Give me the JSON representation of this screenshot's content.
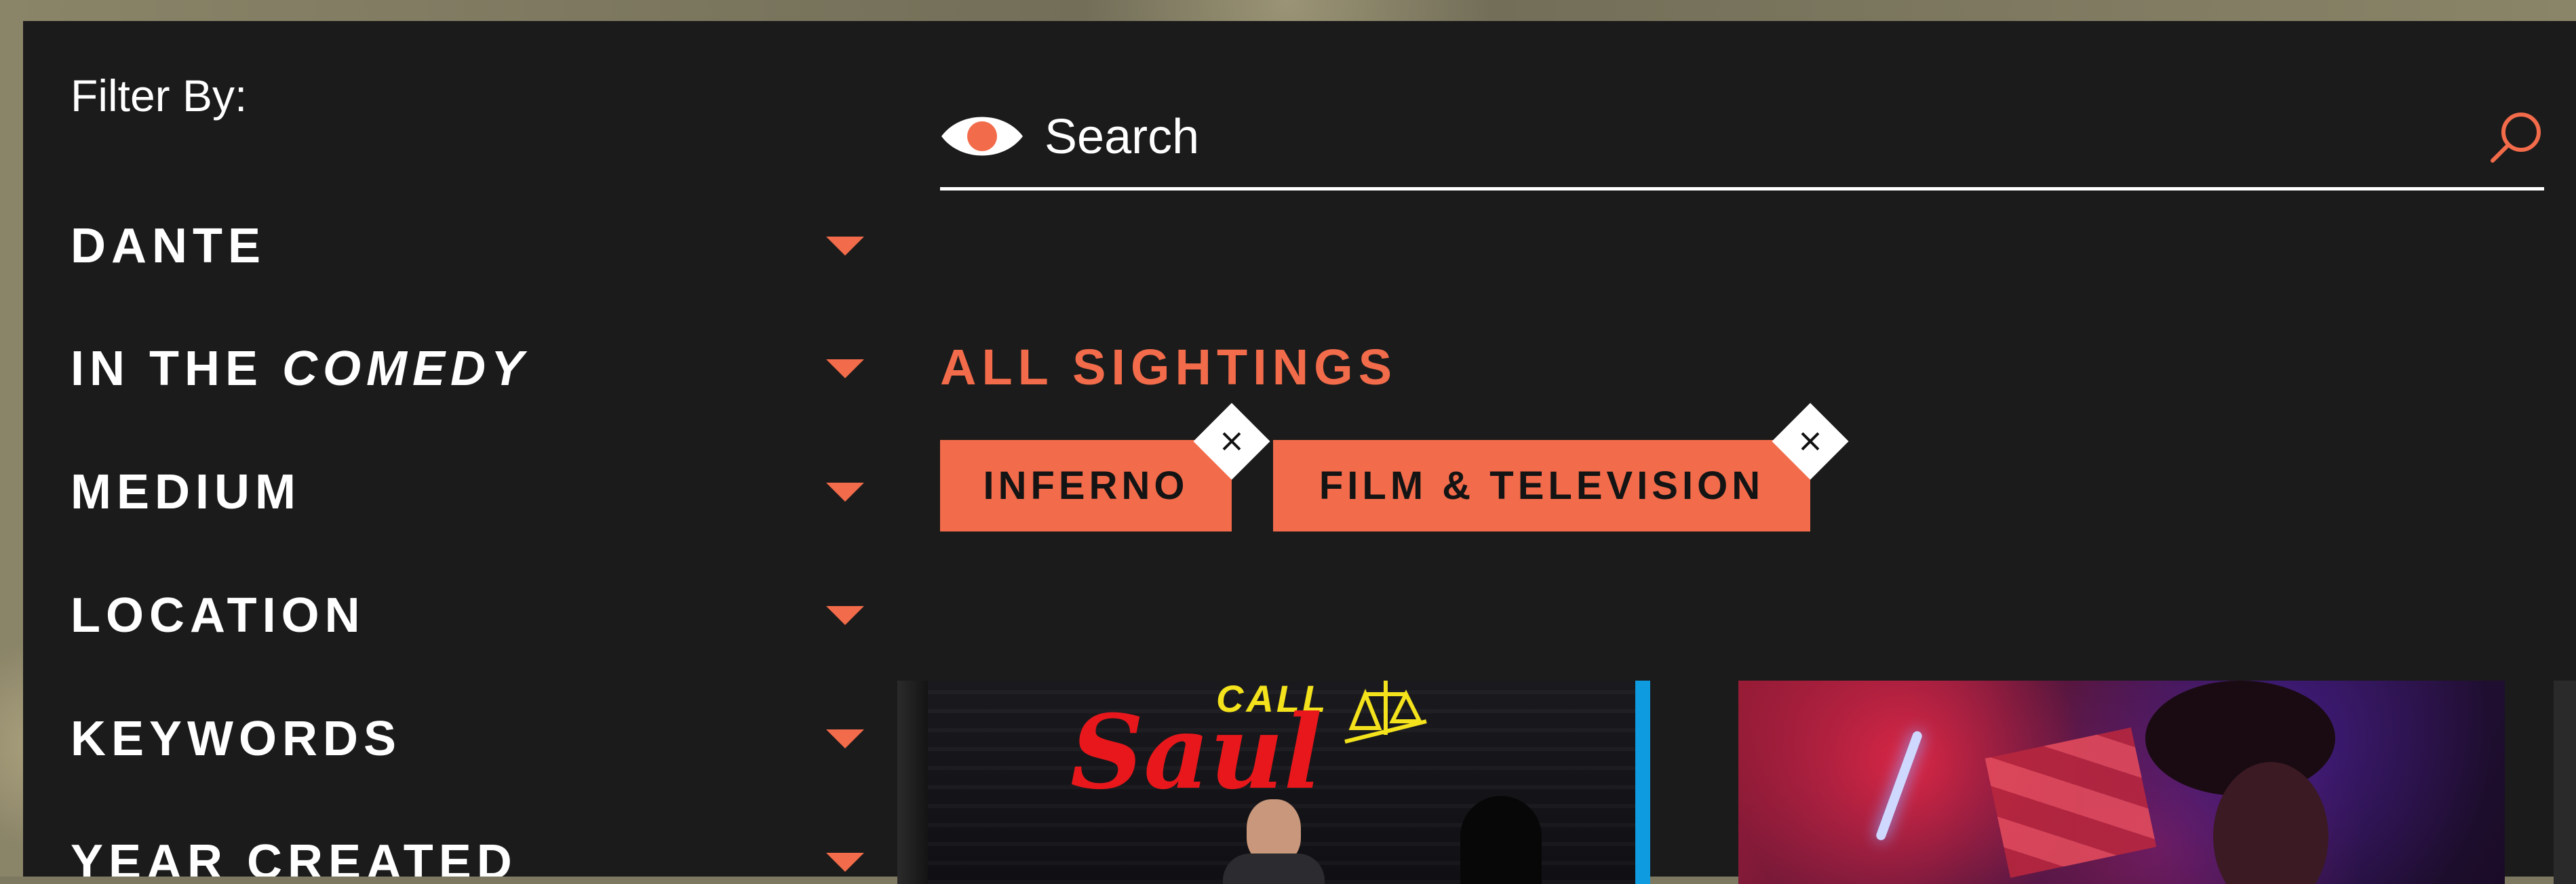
{
  "filter": {
    "title": "Filter By:",
    "items": [
      {
        "label": "DANTE"
      },
      {
        "label_prefix": "IN THE ",
        "label_emphasis": "COMEDY"
      },
      {
        "label": "MEDIUM"
      },
      {
        "label": "LOCATION"
      },
      {
        "label": "KEYWORDS"
      },
      {
        "label": "YEAR CREATED"
      }
    ]
  },
  "search": {
    "placeholder": "Search",
    "icon": "search-icon",
    "leading_icon": "eye-icon"
  },
  "results": {
    "section_title": "ALL SIGHTINGS",
    "active_filters": [
      {
        "label": "INFERNO"
      },
      {
        "label": "FILM & TELEVISION"
      }
    ],
    "cards": [
      {
        "poster_text_top": "CALL",
        "poster_text_main": "Saul"
      }
    ]
  },
  "colors": {
    "accent": "#f26b4a",
    "panel": "#1b1b1b",
    "text": "#ffffff"
  }
}
